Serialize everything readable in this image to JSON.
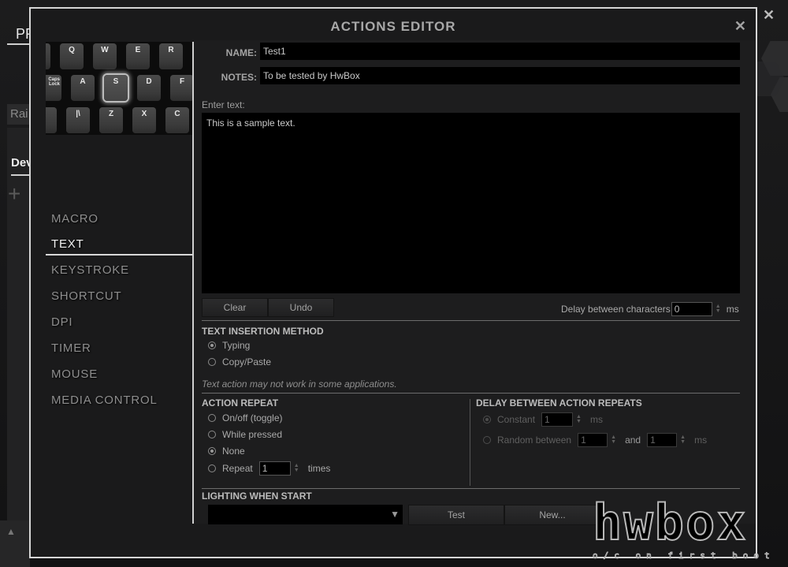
{
  "background": {
    "tab_fragment": "PR",
    "profile_fragment": "Rai",
    "device_fragment": "Dev",
    "add_glyph": "+",
    "close_glyph": "✕",
    "scroll_up_glyph": "▲"
  },
  "modal": {
    "title": "ACTIONS EDITOR",
    "close_glyph": "✕"
  },
  "keyboard": {
    "rows": [
      [
        "",
        "Q",
        "W",
        "E",
        "R"
      ],
      [
        "Caps Lock",
        "A",
        "S",
        "D",
        "F"
      ],
      [
        "",
        "|\\",
        "Z",
        "X",
        "C"
      ]
    ],
    "selected_key": "S"
  },
  "nav": {
    "items": [
      {
        "label": "MACRO"
      },
      {
        "label": "TEXT",
        "active": true
      },
      {
        "label": "KEYSTROKE"
      },
      {
        "label": "SHORTCUT"
      },
      {
        "label": "DPI"
      },
      {
        "label": "TIMER"
      },
      {
        "label": "MOUSE"
      },
      {
        "label": "MEDIA CONTROL"
      }
    ]
  },
  "form": {
    "name_label": "NAME:",
    "name_value": "Test1",
    "notes_label": "NOTES:",
    "notes_value": "To be tested by HwBox",
    "enter_text_label": "Enter text:",
    "text_value": "This is a sample text.",
    "clear_label": "Clear",
    "undo_label": "Undo",
    "delay_chars_label": "Delay between characters",
    "delay_chars_value": "0",
    "delay_chars_unit": "ms"
  },
  "insertion": {
    "heading": "TEXT INSERTION METHOD",
    "options": [
      {
        "label": "Typing",
        "selected": true
      },
      {
        "label": "Copy/Paste",
        "selected": false
      }
    ],
    "note": "Text action may not work in some applications."
  },
  "repeat": {
    "heading": "ACTION REPEAT",
    "options": [
      {
        "label": "On/off (toggle)",
        "selected": false
      },
      {
        "label": "While pressed",
        "selected": false
      },
      {
        "label": "None",
        "selected": true
      },
      {
        "label": "Repeat",
        "selected": false
      }
    ],
    "repeat_count": "1",
    "times_label": "times"
  },
  "delay_repeats": {
    "heading": "DELAY BETWEEN ACTION REPEATS",
    "constant_label": "Constant",
    "constant_value": "1",
    "constant_unit": "ms",
    "random_label": "Random between",
    "random_min": "1",
    "and_label": "and",
    "random_max": "1",
    "random_unit": "ms",
    "enabled": false
  },
  "lighting": {
    "heading": "LIGHTING WHEN START",
    "selected_value": "",
    "dropdown_glyph": "▼",
    "test_label": "Test",
    "new_label": "New..."
  },
  "watermark": {
    "brand": "hwbox",
    "tagline": "o/c on first boot"
  }
}
